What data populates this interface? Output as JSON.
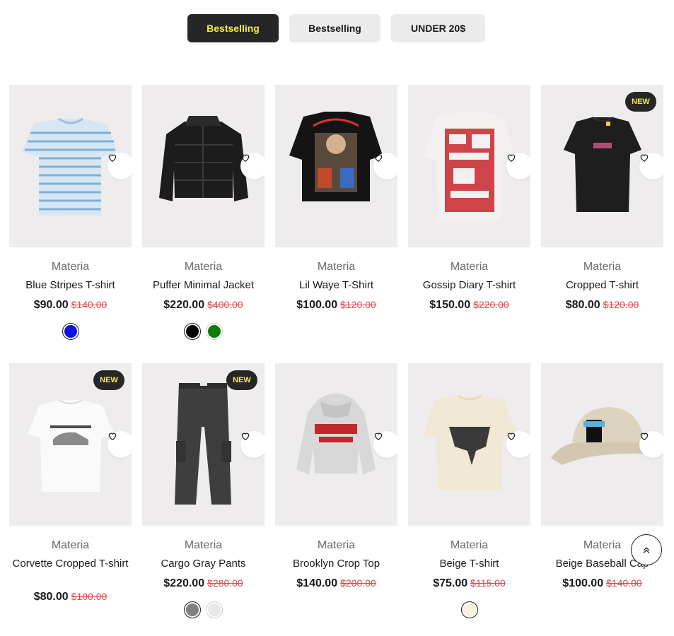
{
  "tabs": [
    {
      "label": "Bestselling",
      "active": true
    },
    {
      "label": "Bestselling",
      "active": false
    },
    {
      "label": "UNDER 20$",
      "active": false
    }
  ],
  "wishlist_icon": "heart-icon",
  "scroll_top_icon": "double-chevron-up-icon",
  "products": [
    {
      "brand": "Materia",
      "name": "Blue Stripes T-shirt",
      "price": "$90.00",
      "old_price": "$140.00",
      "badge": "",
      "swatches": [
        "#1010e0"
      ]
    },
    {
      "brand": "Materia",
      "name": "Puffer Minimal Jacket",
      "price": "$220.00",
      "old_price": "$400.00",
      "badge": "",
      "swatches": [
        "#000000",
        "#0a7d0a"
      ]
    },
    {
      "brand": "Materia",
      "name": "Lil Waye T-Shirt",
      "price": "$100.00",
      "old_price": "$120.00",
      "badge": "",
      "swatches": []
    },
    {
      "brand": "Materia",
      "name": "Gossip Diary T-shirt",
      "price": "$150.00",
      "old_price": "$220.00",
      "badge": "",
      "swatches": []
    },
    {
      "brand": "Materia",
      "name": "Cropped T-shirt",
      "price": "$80.00",
      "old_price": "$120.00",
      "badge": "NEW",
      "swatches": []
    },
    {
      "brand": "Materia",
      "name": "Corvette Cropped T-shirt",
      "price": "$80.00",
      "old_price": "$100.00",
      "badge": "NEW",
      "swatches": []
    },
    {
      "brand": "Materia",
      "name": "Cargo Gray Pants",
      "price": "$220.00",
      "old_price": "$280.00",
      "badge": "NEW",
      "swatches": [
        "#808080",
        "#e8e8e8"
      ]
    },
    {
      "brand": "Materia",
      "name": "Brooklyn Crop Top",
      "price": "$140.00",
      "old_price": "$200.00",
      "badge": "",
      "swatches": []
    },
    {
      "brand": "Materia",
      "name": "Beige T-shirt",
      "price": "$75.00",
      "old_price": "$115.00",
      "badge": "",
      "swatches": [
        "#f6f2dc"
      ]
    },
    {
      "brand": "Materia",
      "name": "Beige Baseball Cap",
      "price": "$100.00",
      "old_price": "$140.00",
      "badge": "",
      "swatches": []
    }
  ]
}
